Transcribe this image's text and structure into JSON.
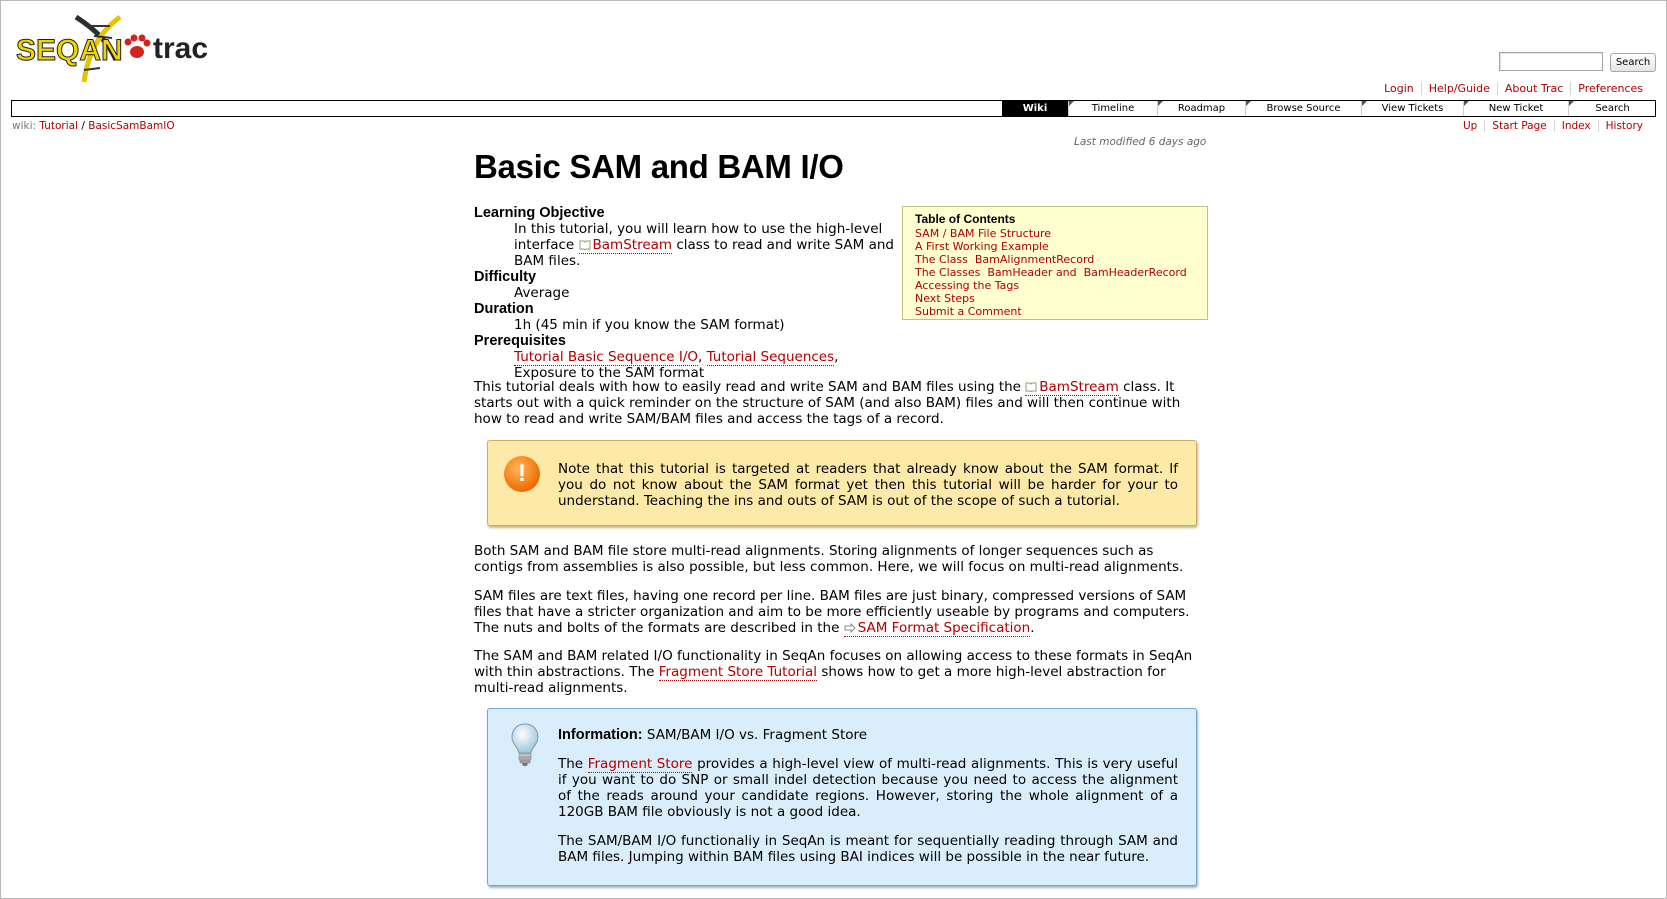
{
  "header": {
    "logo_text_left": "SEQAN",
    "logo_text_right": "trac",
    "search_button": "Search",
    "metanav": [
      "Login",
      "Help/Guide",
      "About Trac",
      "Preferences"
    ]
  },
  "mainnav": {
    "tabs": [
      "Wiki",
      "Timeline",
      "Roadmap",
      "Browse Source",
      "View Tickets",
      "New Ticket",
      "Search"
    ],
    "active": "Wiki"
  },
  "ctxnav": {
    "prefix": "wiki:",
    "crumb1": "Tutorial",
    "sep": "/",
    "crumb2": "BasicSamBamIO",
    "links": [
      "Up",
      "Start Page",
      "Index",
      "History"
    ]
  },
  "page": {
    "last_modified": "Last modified 6 days ago",
    "title": "Basic SAM and BAM I/O",
    "definitions": {
      "learning_objective_term": "Learning Objective",
      "learning_objective_pre": "In this tutorial, you will learn how to use the high-level interface",
      "learning_objective_link": "BamStream",
      "learning_objective_post": "class to read and write SAM and BAM files.",
      "difficulty_term": "Difficulty",
      "difficulty_value": "Average",
      "duration_term": "Duration",
      "duration_value": "1h (45 min if you know the SAM format)",
      "prerequisites_term": "Prerequisites",
      "prereq_link1": "Tutorial Basic Sequence I/O",
      "prereq_sep": ",",
      "prereq_link2": "Tutorial Sequences",
      "prereq_post": ", Exposure to the SAM format"
    },
    "toc": {
      "title": "Table of Contents",
      "items": [
        "SAM / BAM File Structure",
        "A First Working Example",
        "The Class  BamAlignmentRecord",
        "The Classes  BamHeader and  BamHeaderRecord",
        "Accessing the Tags",
        "Next Steps",
        "Submit a Comment"
      ]
    },
    "intro_pre": "This tutorial deals with how to easily read and write SAM and BAM files using the",
    "intro_link": "BamStream",
    "intro_post": "class. It starts out with a quick reminder on the structure of SAM (and also BAM) files and will then continue with how to read and write SAM/BAM files and access the tags of a record.",
    "warning": "Note that this tutorial is targeted at readers that already know about the SAM format. If you do not know about the SAM format yet then this tutorial will be harder for your to understand. Teaching the ins and outs of SAM is out of the scope of such a tutorial.",
    "para1": "Both SAM and BAM file store multi-read alignments. Storing alignments of longer sequences such as contigs from assemblies is also possible, but less common. Here, we will focus on multi-read alignments.",
    "para2_pre": "SAM files are text files, having one record per line. BAM files are just binary, compressed versions of SAM files that have a stricter organization and aim to be more efficiently useable by programs and computers. The nuts and bolts of the formats are described in the",
    "para2_link": "SAM Format Specification",
    "para2_post": ".",
    "para3_pre": "The SAM and BAM related I/O functionality in SeqAn focuses on allowing access to these formats in SeqAn with thin abstractions. The",
    "para3_link": "Fragment Store Tutorial",
    "para3_post": "shows how to get a more high-level abstraction for multi-read alignments.",
    "info": {
      "title_bold": "Information:",
      "title_rest": "SAM/BAM I/O vs. Fragment Store",
      "p1_pre": "The",
      "p1_link": "Fragment Store",
      "p1_post": "provides a high-level view of multi-read alignments. This is very useful if you want to do SNP or small indel detection because you need to access the alignment of the reads around your candidate regions. However, storing the whole alignment of a 120GB BAM file obviously is not a good idea.",
      "p2": "The SAM/BAM I/O functionaliy in SeqAn is meant for sequentially reading through SAM and BAM files. Jumping within BAM files using BAI indices will be possible in the near future."
    }
  },
  "colors": {
    "link": "#b00000",
    "toc_bg": "#ffffd0",
    "warning_bg": "#fde9a8",
    "info_bg": "#d9eefa",
    "active_tab": "#000000"
  }
}
